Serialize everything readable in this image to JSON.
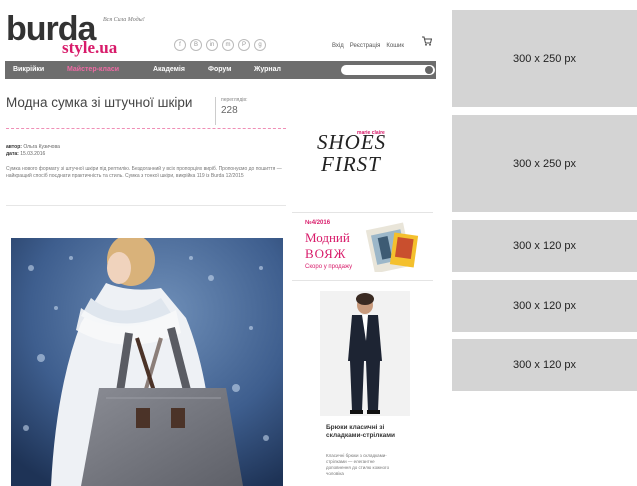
{
  "header": {
    "logo_main": "burda",
    "logo_sub": "style.ua",
    "tagline": "Вся Сила Моды!",
    "social_icons": [
      "f",
      "B",
      "in",
      "m",
      "P",
      "g"
    ],
    "user_links": [
      "Вхід",
      "Реєстрація",
      "Кошик"
    ]
  },
  "nav": {
    "items": [
      "Викрійки",
      "Майстер-класи",
      "Академія",
      "Форум",
      "Журнал"
    ],
    "search_placeholder": ""
  },
  "article": {
    "title": "Модна сумка зі штучної шкіри",
    "views_label": "переглядів:",
    "views_count": "228",
    "author_label": "автор:",
    "author": "Ольга Кузичова",
    "date_label": "дата:",
    "date": "15.03.2016",
    "description": "Сумка нового формату зі штучної шкіри під рептилію. Бездоганний у всіх пропорціях виріб. Пропонуємо до пошиття — найкращий спосіб поєднати практичність та стиль. Сумка з тонкої шкіри, викрійка 119 із Burda 12/2015"
  },
  "ads": {
    "shoes_line1": "SHOES",
    "shoes_line2": "FIRST",
    "shoes_brand": "marie claire",
    "mag_issue": "№4/2016",
    "mag_title1": "Модний",
    "mag_title2": "ВОЯЖ",
    "mag_soon": "Скоро у продажу",
    "pants_title": "Брюки класичні зі складками-стрілками",
    "pants_text": "Класичні брюки з складками-стрілками — елегантне доповнення до стилю кожного чоловіка"
  },
  "placeholders": [
    "300 x 250 px",
    "300 x 250 px",
    "300 x 120 px",
    "300 x 120 px",
    "300 x 120 px"
  ],
  "colors": {
    "brand_pink": "#d81b6a",
    "nav_bg": "#6d6d6d",
    "nav_accent": "#f06aa4",
    "placeholder_bg": "#d4d4d4"
  }
}
